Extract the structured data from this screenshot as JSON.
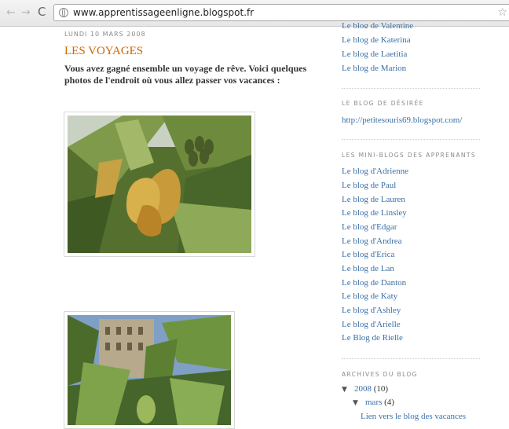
{
  "browser": {
    "url": "www.apprentissageenligne.blogspot.fr",
    "back_icon": "←",
    "forward_icon": "→",
    "reload_icon": "C",
    "star_icon": "☆"
  },
  "post": {
    "date": "LUNDI 10 MARS 2008",
    "title": "LES VOYAGES",
    "body": "Vous avez gagné ensemble un voyage de rêve. Voici quelques photos de l'endroit où vous allez passer vos vacances :"
  },
  "sidebar": {
    "top_cut_link": "Le blog de Valentine",
    "top_links": [
      "Le blog de Katerina",
      "Le blog de Laetitia",
      "Le blog de Marion"
    ],
    "desiree_heading": "LE BLOG DE DÉSIRÉE",
    "desiree_link": "http://petitesouris69.blogspot.com/",
    "mini_heading": "LES MINI-BLOGS DES APPRENANTS",
    "mini_links": [
      "Le blog d'Adrienne",
      "Le blog de Paul",
      "Le blog de Lauren",
      "Le blog de Linsley",
      "Le blog d'Edgar",
      "Le blog d'Andrea",
      "Le blog d'Erica",
      "Le blog de Lan",
      "Le blog de Danton",
      "Le blog de Katy",
      "Le blog d'Ashley",
      "Le blog d'Arielle",
      "Le Blog de Rielle"
    ],
    "archive_heading": "ARCHIVES DU BLOG",
    "archive_toggle": "▼",
    "archive_year": "2008",
    "archive_year_count": "(10)",
    "archive_month": "mars",
    "archive_month_count": "(4)",
    "archive_post": "Lien vers le blog des vacances"
  }
}
